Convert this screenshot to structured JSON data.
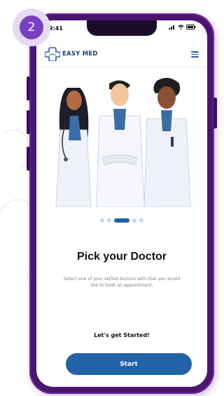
{
  "step_badge": "2",
  "status_bar": {
    "time": "9:41"
  },
  "header": {
    "logo_text": "EASY MED"
  },
  "carousel": {
    "page_count": 5,
    "active_index": 2
  },
  "content": {
    "title": "Pick your Doctor",
    "subtitle": "Select one of your skilled doctors with that you would like to book an appointment.",
    "cta_label": "Let's get Started!",
    "start_button": "Start"
  },
  "colors": {
    "brand_blue": "#2262a6",
    "phone_frame": "#4a1571",
    "badge_purple": "#7a3fc0"
  }
}
